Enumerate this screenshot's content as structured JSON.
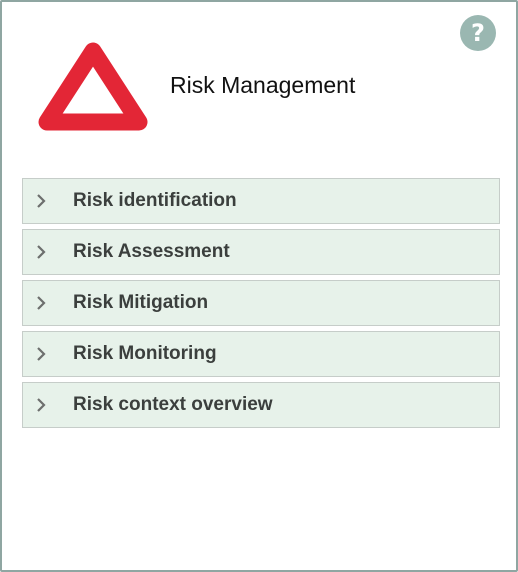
{
  "header": {
    "title": "Risk Management",
    "help_icon": "question-mark-icon",
    "logo_icon": "warning-triangle-icon",
    "help_glyph": "?"
  },
  "menu": {
    "items": [
      {
        "label": "Risk identification"
      },
      {
        "label": "Risk Assessment"
      },
      {
        "label": "Risk Mitigation"
      },
      {
        "label": "Risk Monitoring"
      },
      {
        "label": "Risk context overview"
      }
    ]
  },
  "colors": {
    "accent_red": "#e32636",
    "item_bg": "#e7f2ea",
    "help_bg": "#9ab7b1",
    "border": "#8fa6a2"
  }
}
